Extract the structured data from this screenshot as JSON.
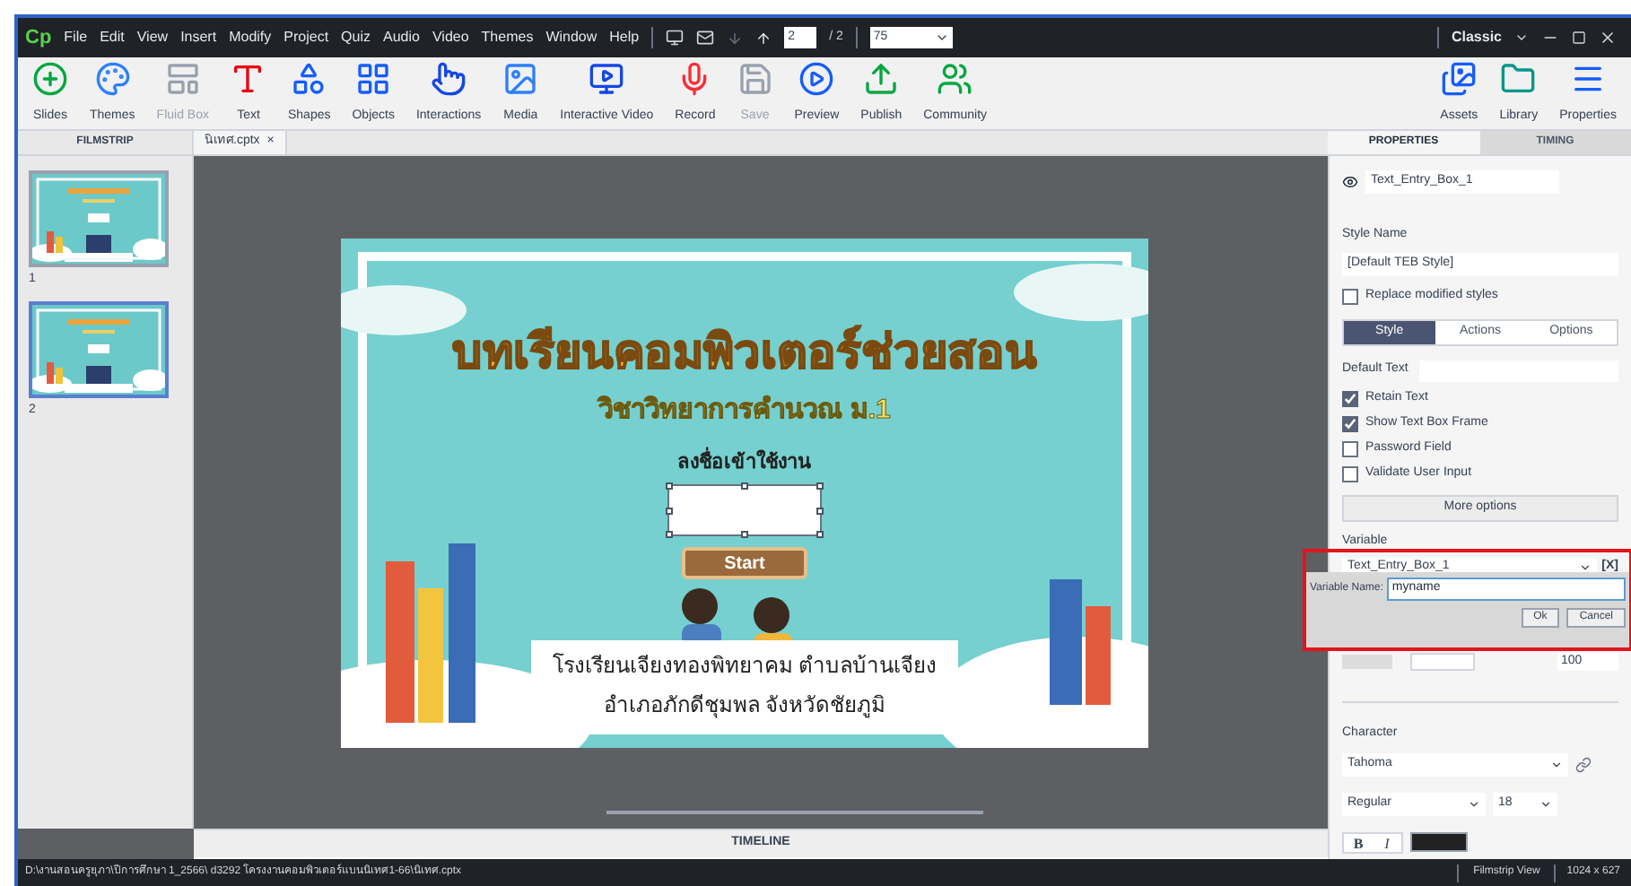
{
  "menubar": {
    "logo": "Cp",
    "menus": [
      "File",
      "Edit",
      "View",
      "Insert",
      "Modify",
      "Project",
      "Quiz",
      "Audio",
      "Video",
      "Themes",
      "Window",
      "Help"
    ],
    "page": "2",
    "page_total": "/ 2",
    "zoom": "75",
    "workspace": "Classic"
  },
  "toolbar": {
    "left": [
      {
        "kind": "slides",
        "label": "Slides",
        "disabled": false
      },
      {
        "kind": "themes",
        "label": "Themes",
        "disabled": false
      },
      {
        "kind": "fluidbox",
        "label": "Fluid Box",
        "disabled": true
      },
      {
        "kind": "text",
        "label": "Text",
        "disabled": false
      },
      {
        "kind": "shapes",
        "label": "Shapes",
        "disabled": false
      },
      {
        "kind": "objects",
        "label": "Objects",
        "disabled": false
      },
      {
        "kind": "interactions",
        "label": "Interactions",
        "disabled": false
      },
      {
        "kind": "media",
        "label": "Media",
        "disabled": false
      },
      {
        "kind": "video",
        "label": "Interactive Video",
        "disabled": false
      },
      {
        "kind": "record",
        "label": "Record",
        "disabled": false
      },
      {
        "kind": "save",
        "label": "Save",
        "disabled": true
      },
      {
        "kind": "preview",
        "label": "Preview",
        "disabled": false
      },
      {
        "kind": "publish",
        "label": "Publish",
        "disabled": false
      },
      {
        "kind": "community",
        "label": "Community",
        "disabled": false
      }
    ],
    "right": [
      {
        "kind": "assets",
        "label": "Assets",
        "disabled": false
      },
      {
        "kind": "library",
        "label": "Library",
        "disabled": false
      },
      {
        "kind": "properties",
        "label": "Properties",
        "disabled": false
      }
    ]
  },
  "filmstrip": {
    "title": "FILMSTRIP",
    "slides": [
      {
        "number": "1",
        "selected": false
      },
      {
        "number": "2",
        "selected": true
      }
    ]
  },
  "document_tab": {
    "label": "นิเทศ.cptx",
    "close": "×"
  },
  "slide": {
    "title": "บทเรียนคอมพิวเตอร์ช่วยสอน",
    "subtitle": "วิชาวิทยาการคำนวณ ม.1",
    "login_label": "ลงชื่อเข้าใช้งาน",
    "button": "Start",
    "footer": [
      "โรงเรียนเจียงทองพิทยาคม ตำบลบ้านเจียง",
      "อำเภอภักดีชุมพล จังหวัดชัยภูมิ"
    ]
  },
  "timeline": {
    "title": "TIMELINE"
  },
  "properties": {
    "tabs": [
      {
        "label": "PROPERTIES",
        "selected": true
      },
      {
        "label": "TIMING",
        "selected": false
      }
    ],
    "object_name": "Text_Entry_Box_1",
    "style_label": "Style Name",
    "style_value": "[Default TEB Style]",
    "replace_styles": {
      "label": "Replace modified styles",
      "checked": false
    },
    "subtabs": [
      {
        "label": "Style",
        "selected": true
      },
      {
        "label": "Actions",
        "selected": false
      },
      {
        "label": "Options",
        "selected": false
      }
    ],
    "default_text_label": "Default Text",
    "options": [
      {
        "label": "Retain Text",
        "checked": true
      },
      {
        "label": "Show Text Box Frame",
        "checked": true
      },
      {
        "label": "Password Field",
        "checked": false
      },
      {
        "label": "Validate User Input",
        "checked": false
      }
    ],
    "more_button": "More options",
    "variable_label": "Variable",
    "variable_value": "Text_Entry_Box_1",
    "variable_button": "[X]",
    "opacity": "100",
    "character_label": "Character",
    "font": "Tahoma",
    "font_style": "Regular",
    "font_size": "18",
    "bold": "B",
    "italic": "I"
  },
  "dialog": {
    "label": "Variable Name:",
    "value": "myname",
    "ok": "Ok",
    "cancel": "Cancel"
  },
  "status_bar": {
    "path": "D:\\งานสอนครูยุภา\\ปีการศึกษา 1_2566\\ d3292 โครงงานคอมพิวเตอร์แบนนิเทศ1-66\\นิเทศ.cptx",
    "view": "Filmstrip View",
    "size": "1024 x 627"
  }
}
